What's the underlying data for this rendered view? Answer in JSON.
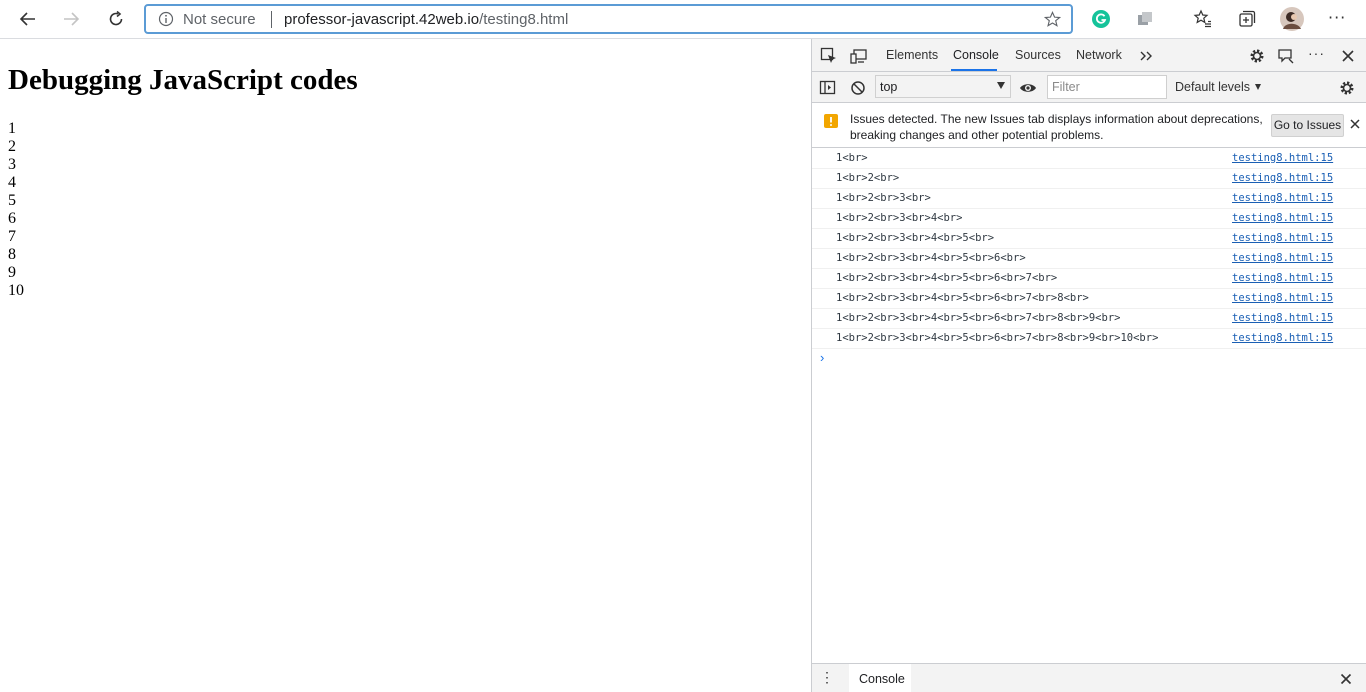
{
  "browser": {
    "security_label": "Not secure",
    "url_host": "professor-javascript.42web.io",
    "url_path": "/testing8.html"
  },
  "page": {
    "heading": "Debugging JavaScript codes",
    "lines": [
      "1",
      "2",
      "3",
      "4",
      "5",
      "6",
      "7",
      "8",
      "9",
      "10"
    ]
  },
  "devtools": {
    "tabs": [
      "Elements",
      "Console",
      "Sources",
      "Network"
    ],
    "active_tab": "Console",
    "context": "top",
    "filter_placeholder": "Filter",
    "levels_label": "Default levels",
    "issues_message": "Issues detected. The new Issues tab displays information about deprecations, breaking changes and other potential problems.",
    "go_to_issues_label": "Go to Issues",
    "console_messages": [
      {
        "text": "1<br>",
        "source": "testing8.html:15"
      },
      {
        "text": "1<br>2<br>",
        "source": "testing8.html:15"
      },
      {
        "text": "1<br>2<br>3<br>",
        "source": "testing8.html:15"
      },
      {
        "text": "1<br>2<br>3<br>4<br>",
        "source": "testing8.html:15"
      },
      {
        "text": "1<br>2<br>3<br>4<br>5<br>",
        "source": "testing8.html:15"
      },
      {
        "text": "1<br>2<br>3<br>4<br>5<br>6<br>",
        "source": "testing8.html:15"
      },
      {
        "text": "1<br>2<br>3<br>4<br>5<br>6<br>7<br>",
        "source": "testing8.html:15"
      },
      {
        "text": "1<br>2<br>3<br>4<br>5<br>6<br>7<br>8<br>",
        "source": "testing8.html:15"
      },
      {
        "text": "1<br>2<br>3<br>4<br>5<br>6<br>7<br>8<br>9<br>",
        "source": "testing8.html:15"
      },
      {
        "text": "1<br>2<br>3<br>4<br>5<br>6<br>7<br>8<br>9<br>10<br>",
        "source": "testing8.html:15"
      }
    ],
    "prompt_symbol": "›",
    "drawer_tab": "Console",
    "drawer_menu": "⋮"
  }
}
